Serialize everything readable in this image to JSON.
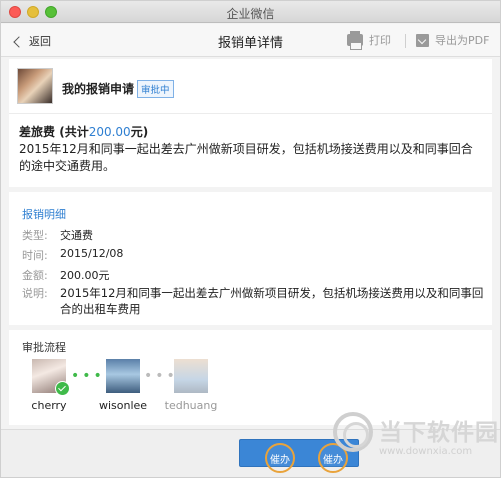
{
  "window": {
    "title": "企业微信"
  },
  "nav": {
    "back_label": "返回",
    "title": "报销单详情",
    "print_label": "打印",
    "export_label": "导出为PDF"
  },
  "request": {
    "heading": "我的报销申请",
    "status": "审批中",
    "category": "差旅费",
    "total_prefix": "(共计",
    "total_amount": "200.00",
    "total_suffix": "元)",
    "description": "2015年12月和同事一起出差去广州做新项目研发，包括机场接送费用以及和同事回合的途中交通费用。"
  },
  "detail": {
    "section_title": "报销明细",
    "rows": [
      {
        "key": "类型:",
        "value": "交通费"
      },
      {
        "key": "时间:",
        "value": "2015/12/08"
      },
      {
        "key": "金额:",
        "value": "200.00元"
      },
      {
        "key": "说明:",
        "value": "2015年12月和同事一起出差去广州做新项目研发，包括机场接送费用以及和同事回合的出租车费用"
      }
    ]
  },
  "flow": {
    "section_title": "审批流程",
    "approvers": [
      {
        "name": "cherry",
        "state": "approved"
      },
      {
        "name": "wisonlee",
        "state": "current"
      },
      {
        "name": "tedhuang",
        "state": "pending"
      }
    ]
  },
  "footer": {
    "urge_label_1": "催办",
    "urge_label_2": "催办"
  },
  "watermark": {
    "brand": "当下软件园",
    "url": "www.downxia.com"
  },
  "colors": {
    "accent": "#2f7fd1",
    "button": "#3b86d6",
    "approved": "#3fba4a",
    "highlight": "#e9a33b"
  }
}
